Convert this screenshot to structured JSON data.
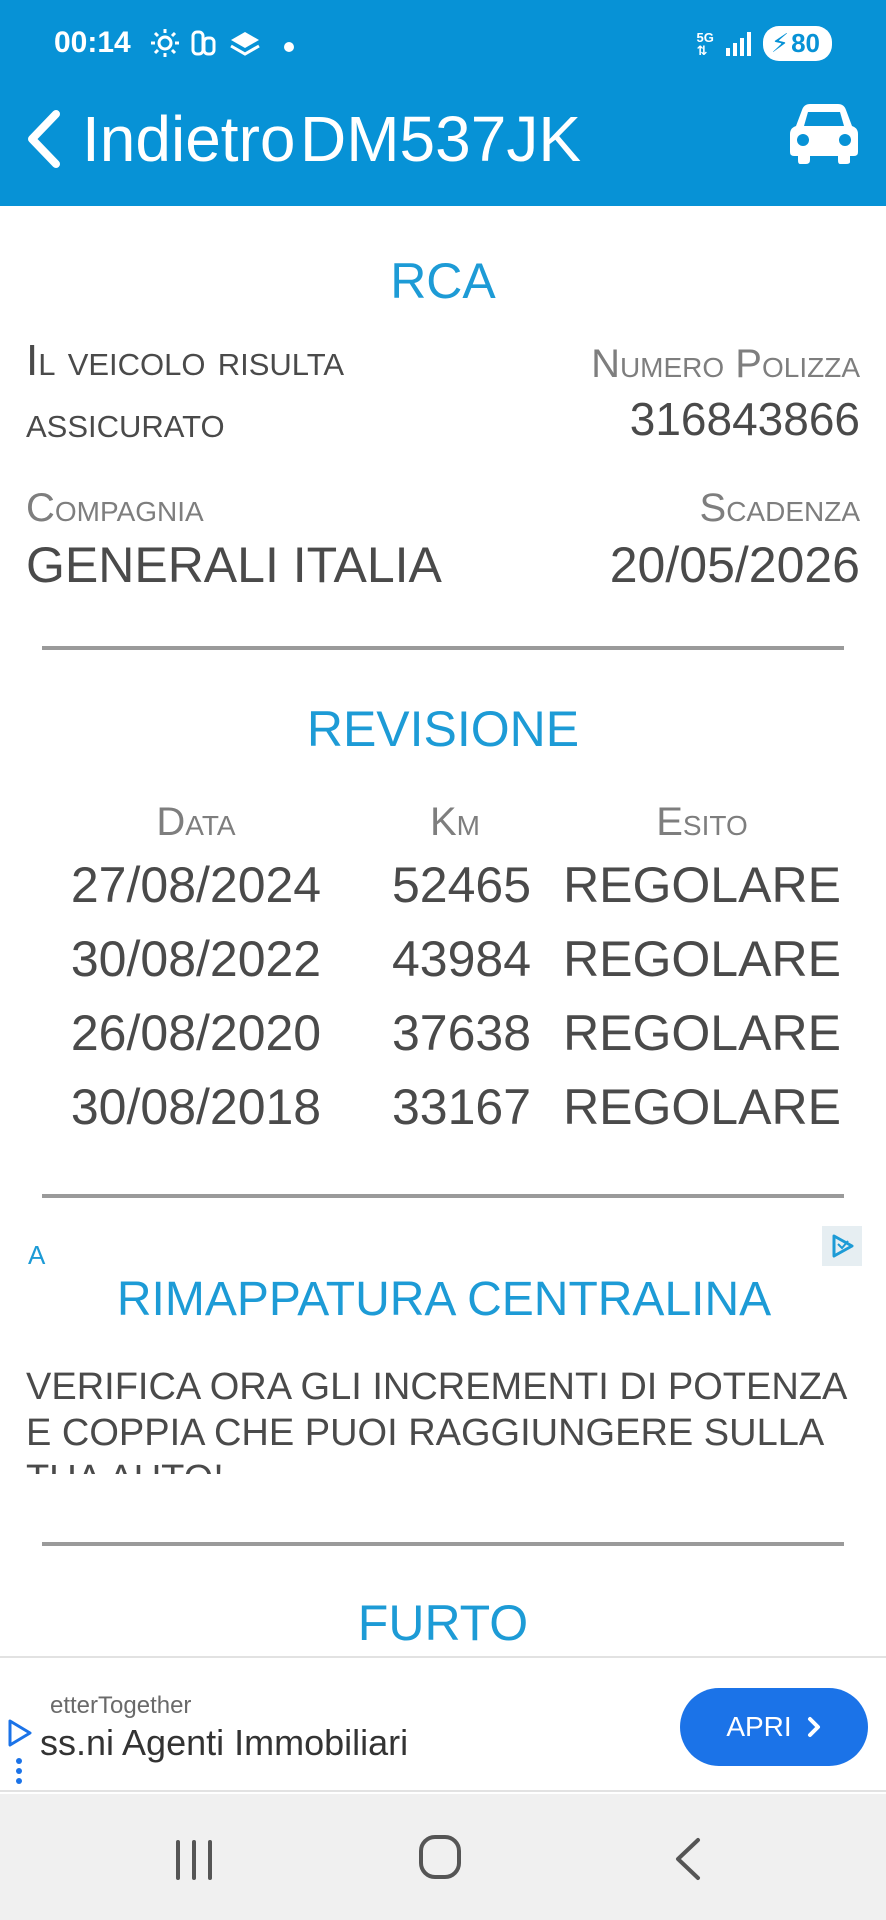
{
  "status_bar": {
    "time": "00:14",
    "network": "5G",
    "battery": "80",
    "icons": [
      "brightness-icon",
      "app-icon",
      "stack-icon",
      "notification-dot"
    ]
  },
  "header": {
    "back_label": "Indietro",
    "title": "DM537JK",
    "action_icon": "car-icon"
  },
  "rca": {
    "title": "RCA",
    "status": "Il veicolo risulta assicurato",
    "policy_label": "Numero Polizza",
    "policy_number": "316843866",
    "company_label": "Compagnia",
    "company": "GENERALI ITALIA",
    "expiry_label": "Scadenza",
    "expiry": "20/05/2026"
  },
  "revisione": {
    "title": "REVISIONE",
    "headers": [
      "Data",
      "Km",
      "Esito"
    ],
    "rows": [
      [
        "27/08/2024",
        "52465",
        "REGOLARE"
      ],
      [
        "30/08/2022",
        "43984",
        "REGOLARE"
      ],
      [
        "26/08/2020",
        "37638",
        "REGOLARE"
      ],
      [
        "30/08/2018",
        "33167",
        "REGOLARE"
      ]
    ]
  },
  "ad": {
    "badge": "A",
    "title": "RIMAPPATURA CENTRALINA",
    "body": "VERIFICA ORA GLI INCREMENTI DI POTENZA E COPPIA CHE PUOI RAGGIUNGERE SULLA TUA AUTO!"
  },
  "furto": {
    "title": "FURTO"
  },
  "banner": {
    "small_text": "etterTogether",
    "main_text": "ss.ni Agenti Immobiliari",
    "button_label": "APRI"
  },
  "colors": {
    "header_bg": "#0792d6",
    "accent": "#1d9bd6",
    "button": "#1b73e8"
  }
}
